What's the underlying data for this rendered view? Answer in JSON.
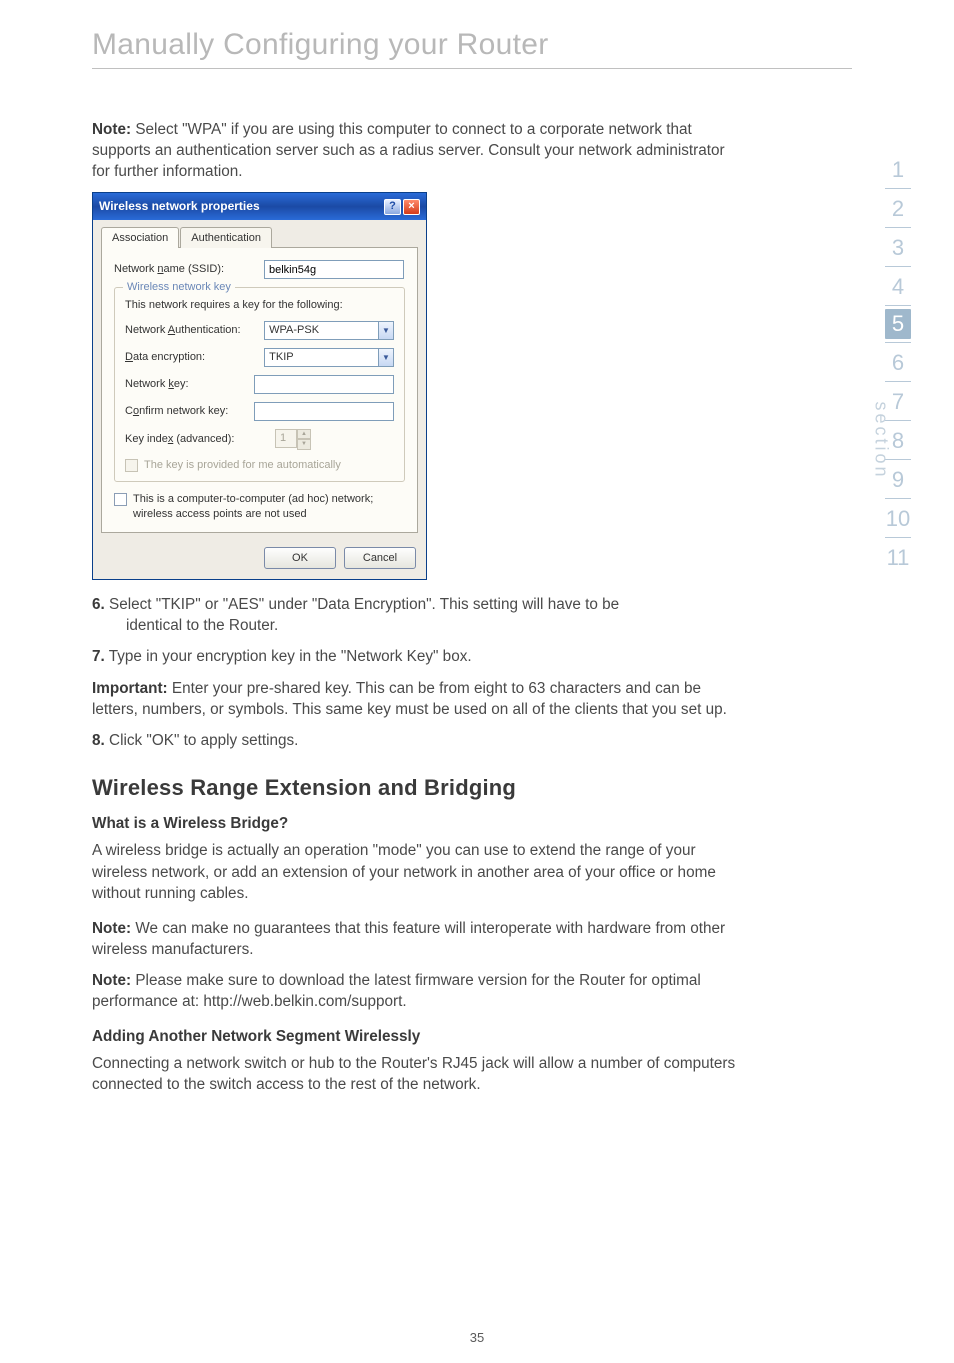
{
  "page": {
    "title": "Manually Configuring your Router",
    "number": "35"
  },
  "body": {
    "note1_label": "Note:",
    "note1_text": " Select \"WPA\" if you are using this computer to connect to a corporate network that supports an authentication server such as a radius server. Consult your network administrator for further information.",
    "step6_num": "6.",
    "step6_text": " Select \"TKIP\" or \"AES\" under \"Data Encryption\". This setting will have to be",
    "step6_cont": "identical to the Router.",
    "step7_num": "7.",
    "step7_text": " Type in your encryption key in the \"Network Key\" box.",
    "important_label": "Important:",
    "important_text": " Enter your pre-shared key. This can be from eight to 63 characters and can be letters, numbers, or symbols. This same key must be used on all of the clients that you set up.",
    "step8_num": "8.",
    "step8_text": " Click \"OK\" to apply settings.",
    "h2": "Wireless Range Extension and Bridging",
    "sub1": "What is a Wireless Bridge?",
    "p1": "A wireless bridge is actually an operation \"mode\" you can use to extend the range of your wireless network, or add an extension of your network in another area of your office or home without running cables.",
    "note2_label": "Note:",
    "note2_text": " We can make no guarantees that this feature will interoperate with hardware from other wireless manufacturers.",
    "note3_label": "Note:",
    "note3_text": " Please make sure to download the latest firmware version for the Router for optimal performance at: http://web.belkin.com/support.",
    "sub2": "Adding Another Network Segment Wirelessly",
    "p2": "Connecting a network switch or hub to the Router's RJ45 jack will allow a number of computers connected to the switch access to the rest of the network."
  },
  "dialog": {
    "title": "Wireless network properties",
    "tab1": "Association",
    "tab2": "Authentication",
    "lbl_ssid_pre": "Network ",
    "lbl_ssid_u": "n",
    "lbl_ssid_post": "ame (SSID):",
    "val_ssid": "belkin54g",
    "group1": "Wireless network key",
    "group1_desc": "This network requires a key for the following:",
    "lbl_auth_pre": "Network ",
    "lbl_auth_u": "A",
    "lbl_auth_post": "uthentication:",
    "val_auth": "WPA-PSK",
    "lbl_enc_u": "D",
    "lbl_enc_post": "ata encryption:",
    "val_enc": "TKIP",
    "lbl_key_pre": "Network ",
    "lbl_key_u": "k",
    "lbl_key_post": "ey:",
    "lbl_confirm_pre": "C",
    "lbl_confirm_u": "o",
    "lbl_confirm_post": "nfirm network key:",
    "lbl_index_pre": "Key inde",
    "lbl_index_u": "x",
    "lbl_index_post": " (advanced):",
    "val_index": "1",
    "chk_auto": "The key is provided for me automatically",
    "chk_adhoc": "This is a computer-to-computer (ad hoc) network; wireless access points are not used",
    "btn_ok": "OK",
    "btn_cancel": "Cancel"
  },
  "sidenav": {
    "items": [
      "1",
      "2",
      "3",
      "4",
      "5",
      "6",
      "7",
      "8",
      "9",
      "10",
      "11"
    ],
    "active_index": 4,
    "label": "section"
  }
}
